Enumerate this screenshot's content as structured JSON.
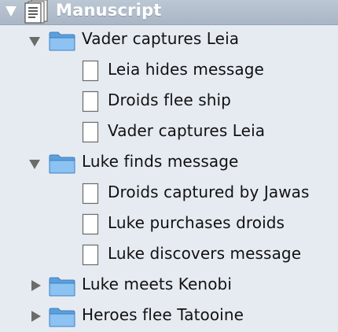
{
  "header": {
    "title": "Manuscript",
    "icon": "manuscript-icon"
  },
  "binder": {
    "groups": [
      {
        "title": "Vader captures Leia",
        "expanded": true,
        "docs": [
          "Leia hides message",
          "Droids flee ship",
          "Vader captures Leia"
        ]
      },
      {
        "title": "Luke finds message",
        "expanded": true,
        "docs": [
          "Droids captured by Jawas",
          "Luke purchases droids",
          "Luke discovers message"
        ]
      },
      {
        "title": "Luke meets Kenobi",
        "expanded": false,
        "docs": []
      },
      {
        "title": "Heroes flee Tatooine",
        "expanded": false,
        "docs": []
      }
    ]
  },
  "colors": {
    "background": "#e6ebf2",
    "header": "#aebacb",
    "folder": "#76b2e8",
    "disclosure": "#6b6b6b"
  }
}
